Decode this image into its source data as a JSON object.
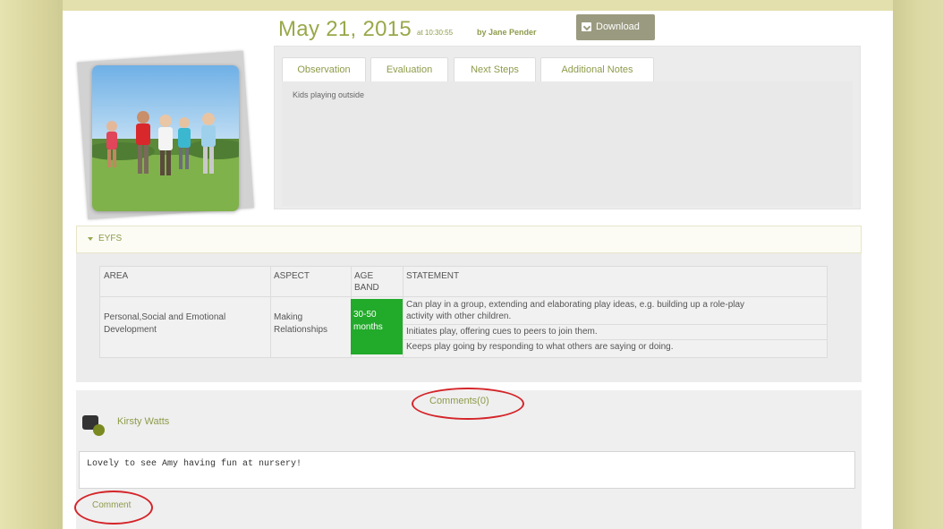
{
  "header": {
    "date": "May 21, 2015",
    "time": "at 10:30:55",
    "author": "by Jane Pender",
    "download_label": "Download"
  },
  "tabs": [
    {
      "label": "Observation"
    },
    {
      "label": "Evaluation"
    },
    {
      "label": "Next Steps"
    },
    {
      "label": "Additional Notes"
    }
  ],
  "observation_text": "Kids playing outside",
  "eyfs": {
    "title": "EYFS",
    "headers": {
      "area": "AREA",
      "aspect": "ASPECT",
      "age_band_1": "AGE",
      "age_band_2": "BAND",
      "statement": "STATEMENT"
    },
    "row": {
      "area_1": "Personal,Social and Emotional",
      "area_2": "Development",
      "aspect_1": "Making",
      "aspect_2": "Relationships",
      "band_1": "30-50",
      "band_2": "months",
      "statements": [
        "Can play in a group, extending and elaborating play ideas, e.g. building up a role-play",
        "activity with other children.",
        "Initiates play, offering cues to peers to join them.",
        "Keeps play going by responding to what others are saying or doing."
      ]
    },
    "band_color": "#22aa2a"
  },
  "comments": {
    "link_label": "Comments(0)",
    "commenter": "Kirsty Watts",
    "input_value": "Lovely to see Amy having fun at nursery!",
    "button_label": "Comment"
  },
  "colors": {
    "accent": "#9aa84a",
    "highlight_ring": "#d4252a"
  }
}
